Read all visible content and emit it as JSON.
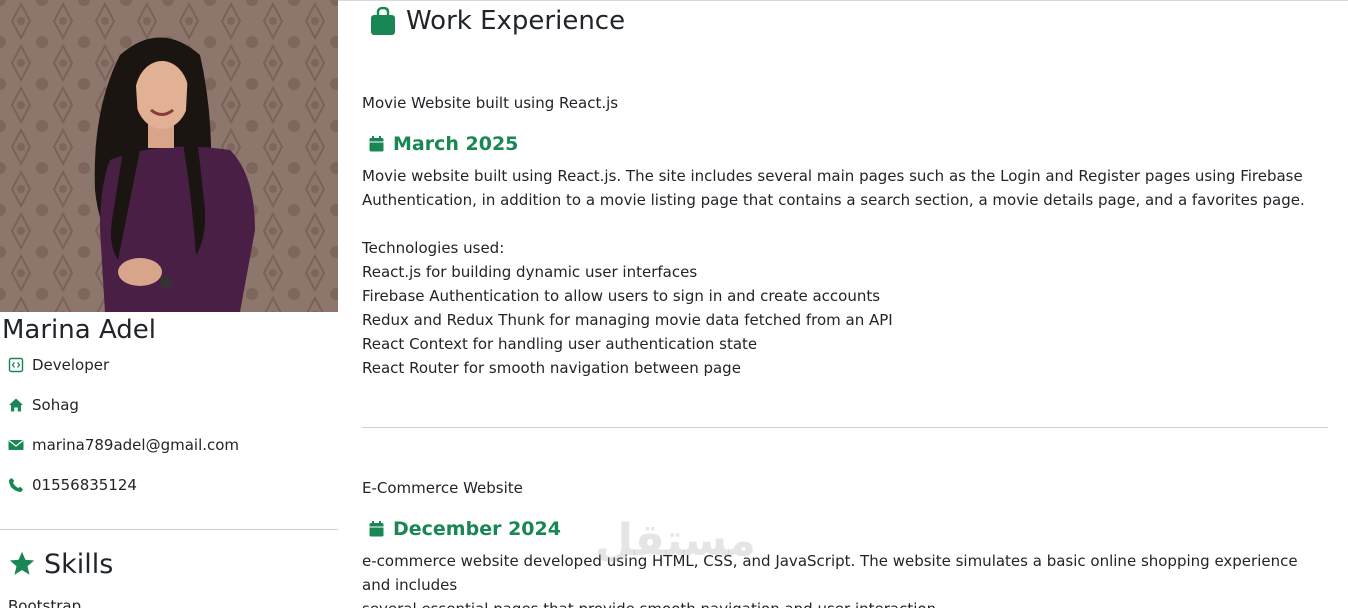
{
  "profile": {
    "name": "Marina Adel",
    "role": "Developer",
    "location": "Sohag",
    "email": "marina789adel@gmail.com",
    "phone": "01556835124",
    "photo_icon": "profile-photo"
  },
  "skills": {
    "title": "Skills",
    "items": [
      "Bootstrap"
    ]
  },
  "experience": {
    "title": "Work Experience",
    "jobs": [
      {
        "title": "Movie Website built using React.js",
        "date": "March 2025",
        "description": [
          "Movie website built using React.js. The site includes several main pages such as the Login and Register pages using Firebase",
          "Authentication, in addition to a movie listing page that contains a search section, a movie details page, and a favorites page."
        ],
        "tech_heading": "Technologies used:",
        "tech": [
          "React.js for building dynamic user interfaces",
          "Firebase Authentication to allow users to sign in and create accounts",
          "Redux and Redux Thunk for managing movie data fetched from an API",
          "React Context for handling user authentication state",
          "React Router for smooth navigation between page"
        ]
      },
      {
        "title": "E-Commerce Website",
        "date": "December 2024",
        "description": [
          "e-commerce website developed using HTML, CSS, and JavaScript. The website simulates a basic online shopping experience and includes",
          "several essential pages that provide smooth navigation and user interaction."
        ]
      }
    ]
  },
  "watermark": "مستقل",
  "colors": {
    "accent": "#198754",
    "text": "#212529",
    "divider": "#cfcfcf"
  },
  "icons": {
    "role": "code-icon",
    "location": "house-icon",
    "email": "envelope-icon",
    "phone": "phone-icon",
    "skills": "star-icon",
    "experience": "briefcase-icon",
    "date": "calendar-icon"
  }
}
